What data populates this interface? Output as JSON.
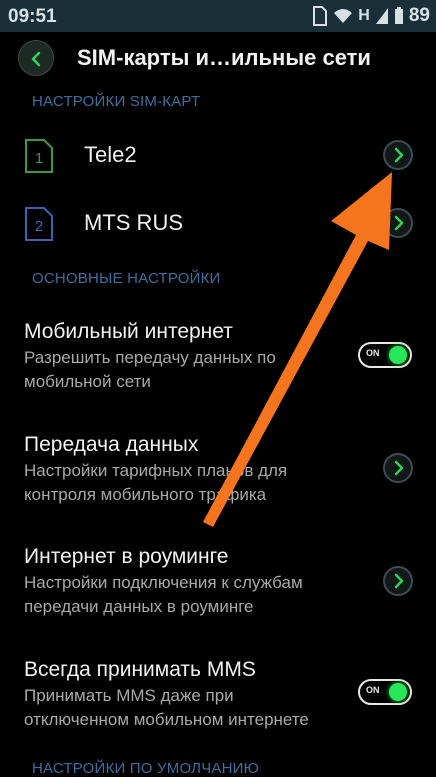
{
  "status_bar": {
    "time": "09:51",
    "network": "H",
    "battery": "89"
  },
  "header": {
    "title": "SIM-карты и…ильные сети"
  },
  "sections": {
    "sim_settings": "НАСТРОЙКИ SIM-КАРТ",
    "main_settings": "ОСНОВНЫЕ НАСТРОЙКИ",
    "default_settings": "НАСТРОЙКИ ПО УМОЛЧАНИЮ"
  },
  "sims": [
    {
      "slot": "1",
      "name": "Tele2",
      "color": "#3f9a3f"
    },
    {
      "slot": "2",
      "name": "MTS RUS",
      "color": "#3a63b8"
    }
  ],
  "settings": [
    {
      "title": "Мобильный интернет",
      "subtitle_1": "Разрешить передачу данных по",
      "subtitle_2": "мобильной сети",
      "control": "toggle",
      "state": "ON"
    },
    {
      "title": "Передача данных",
      "subtitle_1": "Настройки тарифных планов для",
      "subtitle_2": "контроля мобильного трафика",
      "control": "chevron"
    },
    {
      "title": "Интернет в роуминге",
      "subtitle_1": "Настройки подключения к службам",
      "subtitle_2": "передачи данных в роуминге",
      "control": "chevron"
    },
    {
      "title": "Всегда принимать MMS",
      "subtitle_1": "Принимать MMS даже при",
      "subtitle_2": "отключенном мобильном интернете",
      "control": "toggle",
      "state": "ON"
    }
  ],
  "colors": {
    "accent_green": "#27e85a",
    "section_blue": "#3d6ea0",
    "annotation_arrow": "#f5741e"
  }
}
